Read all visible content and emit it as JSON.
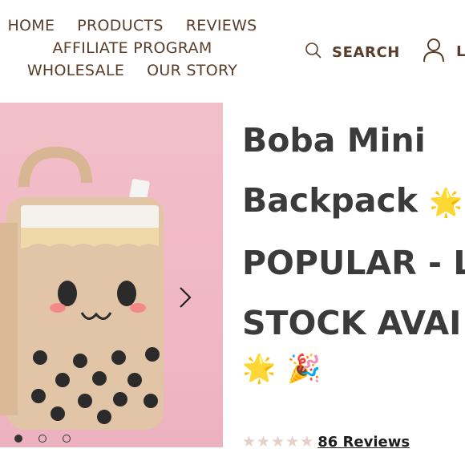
{
  "nav": {
    "row1": [
      "HOME",
      "PRODUCTS",
      "REVIEWS"
    ],
    "row2": [
      "AFFILIATE PROGRAM"
    ],
    "row3": [
      "WHOLESALE",
      "OUR STORY"
    ]
  },
  "header": {
    "search_label": "SEARCH",
    "account_label": "L"
  },
  "product": {
    "title_lines": [
      "Boba Mini",
      "Backpack",
      "POPULAR - LI",
      "STOCK AVAI"
    ],
    "emoji_star": "🌟",
    "emoji_party": "🎉",
    "rating": {
      "stars": 5,
      "reviews_label": "86 Reviews"
    }
  },
  "gallery": {
    "slide_count": 3,
    "active_slide": 1
  },
  "colors": {
    "nav_text": "#5a3e2b",
    "background_pink": "#f0b8c5",
    "bag_tan": "#e2c4a6",
    "star_inactive": "#e6cfc8"
  }
}
